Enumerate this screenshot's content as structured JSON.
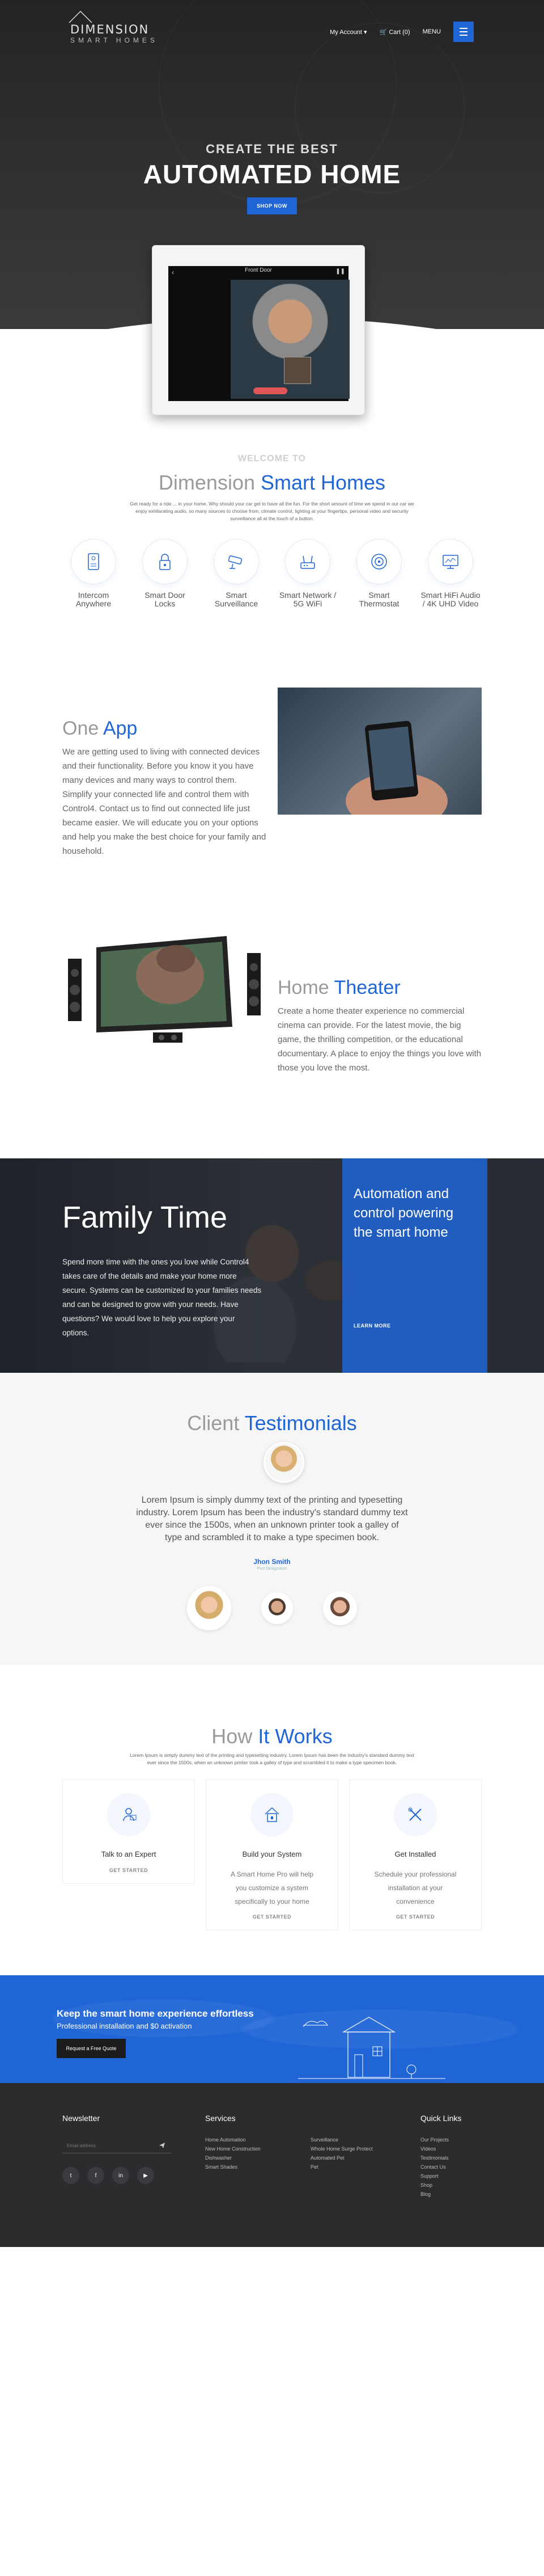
{
  "nav": {
    "logo_line1": "DIMENSION",
    "logo_line2": "SMART HOMES",
    "account": "My Account ▾",
    "cart": "Cart (0)",
    "menu": "MENU"
  },
  "hero": {
    "subtitle": "CREATE THE BEST",
    "title": "AUTOMATED HOME",
    "button": "SHOP NOW",
    "tablet_caption": "Front Door"
  },
  "welcome": {
    "eyebrow": "WELCOME TO",
    "title_grey": "Dimension",
    "title_blue": "Smart Homes",
    "text": "Get ready for a ride ... in your home. Why should your car get to have all the fun. For the short amount of time we spend in our car we enjoy exhilarating audio, so many sources to choose from, climate control, lighting at your fingertips, personal video and security surveillance all at the touch of a button."
  },
  "features": [
    {
      "label": "Intercom Anywhere",
      "icon": "intercom-icon"
    },
    {
      "label": "Smart Door Locks",
      "icon": "lock-icon"
    },
    {
      "label": "Smart Surveillance",
      "icon": "camera-icon"
    },
    {
      "label": "Smart Network / 5G WiFi",
      "icon": "router-icon"
    },
    {
      "label": "Smart Thermostat",
      "icon": "thermostat-icon"
    },
    {
      "label": "Smart HiFi Audio / 4K UHD Video",
      "icon": "monitor-icon"
    }
  ],
  "oneapp": {
    "title_grey": "One",
    "title_blue": "App",
    "text": "We are getting used to living with connected devices and their functionality. Before you know it you have many devices and many ways to control them. Simplify your connected life and control them with Control4. Contact us to find out connected life just became easier. We will educate you on your options and help you make the best choice for your family and household."
  },
  "theater": {
    "title_grey": "Home",
    "title_blue": "Theater",
    "text": "Create a home theater experience no commercial cinema can provide. For the latest movie, the big game, the thrilling competition, or the educational documentary. A place to enjoy the things you love with those you love the most."
  },
  "family": {
    "title": "Family Time",
    "text": "Spend more time with the ones you love while Control4 takes care of the details and make your home more secure. Systems can be customized to your families needs and can be designed to grow with your needs. Have questions? We would love to help you explore your options.",
    "panel_text": "Automation and control powering the smart home",
    "learn_more": "LEARN MORE"
  },
  "testimonials": {
    "title_grey": "Client",
    "title_blue": "Testimonials",
    "quote": "Lorem Ipsum is simply dummy text of the printing and typesetting industry. Lorem Ipsum has been the industry's standard dummy text ever since the 1500s, when an unknown printer took a galley of type and scrambled it to make a type specimen book.",
    "name": "Jhon Smith",
    "role": "Post Designation"
  },
  "how": {
    "title_grey": "How",
    "title_blue": "It Works",
    "text": "Lorem Ipsum is simply dummy text of the printing and typesetting industry. Lorem Ipsum has been the industry's standard dummy text ever since the 1500s, when an unknown printer took a galley of type and scrambled it to make a type specimen book.",
    "cards": [
      {
        "title": "Talk to an Expert",
        "desc": "",
        "link": "GET STARTED",
        "icon": "expert-icon"
      },
      {
        "title": "Build your System",
        "desc": "A Smart Home Pro will help you customize a system specifically to your home",
        "link": "GET STARTED",
        "icon": "house-icon"
      },
      {
        "title": "Get Installed",
        "desc": "Schedule your professional installation at your convenience",
        "link": "GET STARTED",
        "icon": "tools-icon"
      }
    ]
  },
  "cta": {
    "title": "Keep the smart home experience effortless",
    "subtitle": "Professional installation and $0 activation",
    "button": "Request a Free Quote"
  },
  "footer": {
    "newsletter_title": "Newsletter",
    "email_placeholder": "Email address",
    "services_title": "Services",
    "services_col1": [
      "Home Automation",
      "New Home Construction",
      "Dishwasher",
      "Smart Shades"
    ],
    "services_col2": [
      "Surveillance",
      "Whole Home Surge Protect",
      "Automated Pet",
      "Pet"
    ],
    "quicklinks_title": "Quick Links",
    "quicklinks": [
      "Our Projects",
      "Videos",
      "Testimonials",
      "Contact Us",
      "Support",
      "Shop",
      "Blog"
    ],
    "social": [
      "t",
      "f",
      "in",
      "▶"
    ]
  },
  "colors": {
    "accent": "#1f65d6",
    "dark": "#2b2c2e"
  }
}
